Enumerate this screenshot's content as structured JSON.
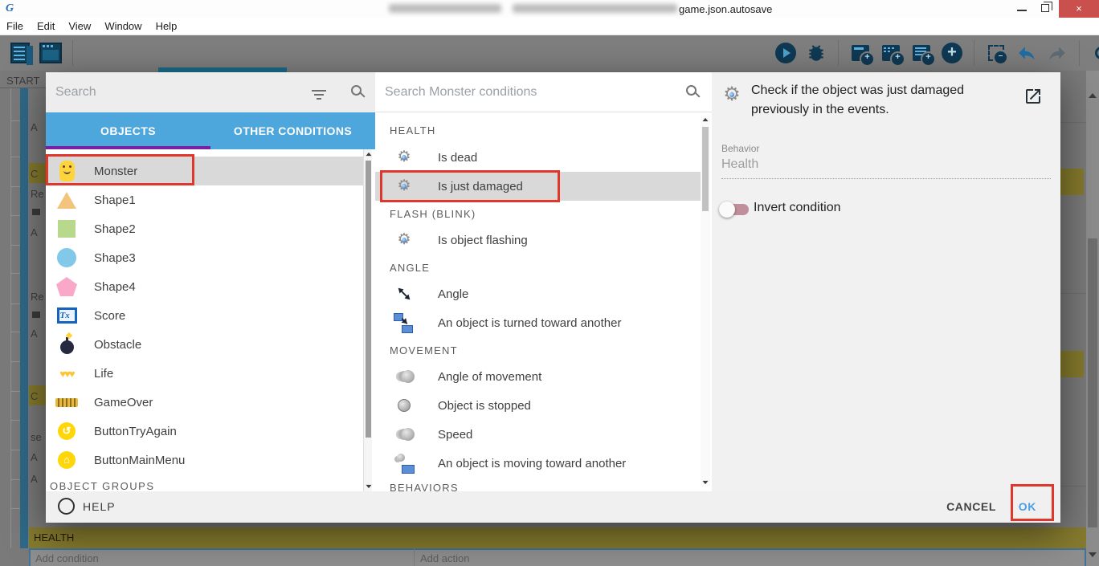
{
  "titlebar": {
    "document_title": "game.json.autosave"
  },
  "menubar": {
    "items": [
      "File",
      "Edit",
      "View",
      "Window",
      "Help"
    ]
  },
  "toolbar": {
    "left_icons": [
      "events-sheet",
      "scene-editor"
    ],
    "right_icons": [
      "preview-play",
      "debugger",
      "add-event",
      "add-subevent",
      "add-comment",
      "add-event-type",
      "delete-event",
      "undo",
      "redo",
      "search"
    ]
  },
  "background": {
    "scene_tab": "START",
    "health_section": "HEALTH",
    "add_condition": "Add condition",
    "add_action": "Add action",
    "fragments": {
      "add": "A",
      "comment": "C",
      "repeat": "Re",
      "sub": "se"
    }
  },
  "dialog": {
    "left_panel": {
      "search_placeholder": "Search",
      "tabs": [
        {
          "label": "OBJECTS",
          "active": true
        },
        {
          "label": "OTHER CONDITIONS",
          "active": false
        }
      ],
      "objects": [
        {
          "icon": "monster-sprite",
          "label": "Monster",
          "selected": true
        },
        {
          "icon": "triangle-sprite",
          "label": "Shape1"
        },
        {
          "icon": "square-sprite",
          "label": "Shape2"
        },
        {
          "icon": "circle-sprite",
          "label": "Shape3"
        },
        {
          "icon": "pentagon-sprite",
          "label": "Shape4"
        },
        {
          "icon": "text-object",
          "label": "Score"
        },
        {
          "icon": "bomb-sprite",
          "label": "Obstacle"
        },
        {
          "icon": "hearts-sprite",
          "label": "Life"
        },
        {
          "icon": "banner-sprite",
          "label": "GameOver"
        },
        {
          "icon": "restart-button",
          "label": "ButtonTryAgain"
        },
        {
          "icon": "home-button",
          "label": "ButtonMainMenu"
        }
      ],
      "groups_header": "OBJECT GROUPS"
    },
    "middle_panel": {
      "search_placeholder": "Search Monster conditions",
      "entries": [
        {
          "type": "header",
          "label": "HEALTH"
        },
        {
          "type": "item",
          "icon": "behavior-gear",
          "label": "Is dead"
        },
        {
          "type": "item",
          "icon": "behavior-gear",
          "label": "Is just damaged",
          "selected": true
        },
        {
          "type": "header",
          "label": "FLASH (BLINK)"
        },
        {
          "type": "item",
          "icon": "behavior-gear",
          "label": "Is object flashing"
        },
        {
          "type": "header",
          "label": "ANGLE"
        },
        {
          "type": "item",
          "icon": "diagonal-arrows",
          "label": "Angle"
        },
        {
          "type": "item",
          "icon": "turned-toward",
          "label": "An object is turned toward another"
        },
        {
          "type": "header",
          "label": "MOVEMENT"
        },
        {
          "type": "item",
          "icon": "moving-circles",
          "label": "Angle of movement"
        },
        {
          "type": "item",
          "icon": "stopped-circle",
          "label": "Object is stopped"
        },
        {
          "type": "item",
          "icon": "moving-circles",
          "label": "Speed"
        },
        {
          "type": "item",
          "icon": "moving-toward",
          "label": "An object is moving toward another"
        },
        {
          "type": "header",
          "label": "BEHAVIORS"
        }
      ]
    },
    "right_panel": {
      "description": "Check if the object was just damaged previously in the events.",
      "behavior_label": "Behavior",
      "behavior_value": "Health",
      "invert_label": "Invert condition"
    },
    "footer": {
      "help_label": "HELP",
      "cancel_label": "CANCEL",
      "ok_label": "OK"
    }
  },
  "colors": {
    "tab_blue": "#4da6dc",
    "tab_underline_purple": "#7b1fa2",
    "selection_gray": "#d9d9d9",
    "tutorial_highlight_red": "#e0362c",
    "ok_text_blue": "#4a9fe8",
    "comment_row_yellow": "#867b2e",
    "close_button_red": "#c9504c"
  }
}
